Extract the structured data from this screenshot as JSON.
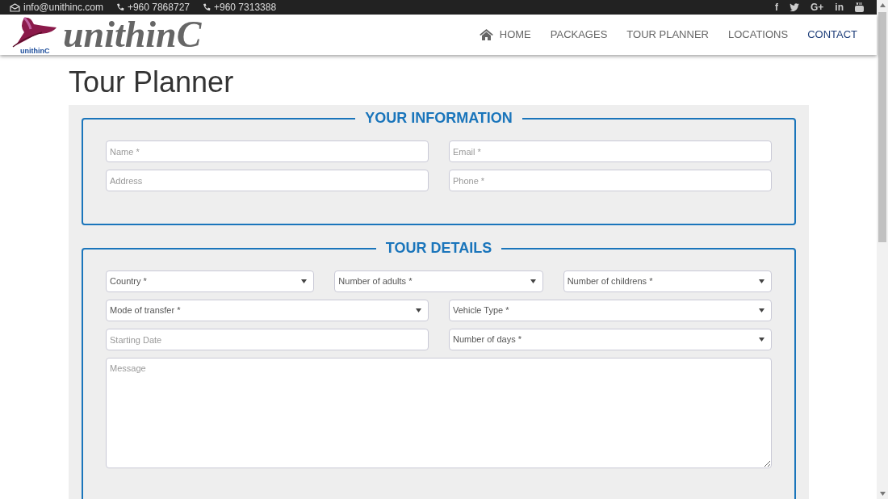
{
  "topbar": {
    "email": "info@unithinc.com",
    "phones": [
      "+960 7868727",
      "+960 7313388"
    ],
    "social": [
      {
        "kind": "glyph",
        "text": "f"
      },
      {
        "kind": "bird"
      },
      {
        "kind": "glyph",
        "text": "G+"
      },
      {
        "kind": "glyph",
        "text": "in"
      },
      {
        "kind": "video"
      }
    ]
  },
  "logo": {
    "small_text": "unithinC",
    "text": "unithinC"
  },
  "nav": [
    {
      "label": "HOME",
      "kind": "home",
      "selected": false
    },
    {
      "label": "PACKAGES",
      "selected": false
    },
    {
      "label": "TOUR PLANNER",
      "selected": false
    },
    {
      "label": "LOCATIONS",
      "selected": false
    },
    {
      "label": "CONTACT",
      "selected": true
    }
  ],
  "page_title": "Tour Planner",
  "sections": [
    {
      "legend": "YOUR INFORMATION",
      "rows": [
        [
          {
            "kind": "input",
            "placeholder": "Name *"
          },
          {
            "kind": "input",
            "placeholder": "Email *"
          }
        ],
        [
          {
            "kind": "input",
            "placeholder": "Address"
          },
          {
            "kind": "input",
            "placeholder": "Phone *"
          }
        ]
      ]
    },
    {
      "legend": "TOUR DETAILS",
      "rows": [
        [
          {
            "kind": "select",
            "value": "Country *"
          },
          {
            "kind": "select",
            "value": "Number of adults *"
          },
          {
            "kind": "select",
            "value": "Number of childrens *"
          }
        ],
        [
          {
            "kind": "select",
            "value": "Mode of transfer *"
          },
          {
            "kind": "select",
            "value": "Vehicle Type *"
          }
        ],
        [
          {
            "kind": "input",
            "placeholder": "Starting Date"
          },
          {
            "kind": "select",
            "value": "Number of days *"
          }
        ],
        [
          {
            "kind": "textarea",
            "placeholder": "Message"
          }
        ]
      ]
    }
  ]
}
